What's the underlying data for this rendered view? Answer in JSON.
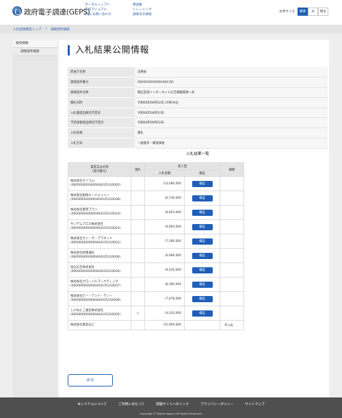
{
  "header": {
    "site_title": "政府電子調達(GEPS)",
    "nav_col1": [
      "ポータルトップへ",
      "操作マニュアル",
      "FAQ･お問い合わせ"
    ],
    "nav_col2": [
      "用語集",
      "トレーニング",
      "調達法令情報"
    ],
    "font_size_label": "文字サイズ",
    "font_sizes": [
      "標準",
      "大",
      "特大"
    ],
    "font_size_selected": "標準"
  },
  "breadcrumb": {
    "items": [
      "入札結果確認トップ",
      "調達案件検索"
    ],
    "separator": ">"
  },
  "sidebar": {
    "heading": "検収情報",
    "items": [
      "調達案件検索"
    ]
  },
  "page": {
    "title": "入札結果公開情報"
  },
  "info": [
    {
      "label": "府省庁名称",
      "value": "法務省"
    },
    {
      "label": "調達案件番号",
      "value": "0000000000000464105"
    },
    {
      "label": "調達案件名称",
      "value": "矯正区域インターネット広告掲載業務一式"
    },
    {
      "label": "開札日時",
      "value": "令和06年08月02日 10時34分"
    },
    {
      "label": "入札書提出締切予定日",
      "value": "令和06年08月02日"
    },
    {
      "label": "予定価格提出締切予定日",
      "value": "令和06年08月02日"
    },
    {
      "label": "入札結果",
      "value": "落札"
    },
    {
      "label": "入札方式",
      "value": "一般競争・最低価格"
    }
  ],
  "results": {
    "title": "入札結果一覧",
    "headers": {
      "name": "業者又は名称\n(受付番号)",
      "award": "落札",
      "round": "第１回",
      "amount": "入札金額",
      "verify": "検証",
      "remarks": "摘要"
    },
    "verify_label": "検証",
    "rows": [
      {
        "name": "株式会社オリコム",
        "no": "(0000000000000464105310002)",
        "award": "",
        "amount": "\\13,480,000",
        "verify": true,
        "remarks": ""
      },
      {
        "name": "株式会社創研エージェンシー",
        "no": "(0000000000000464105310008)",
        "award": "",
        "amount": "\\6,730,000",
        "verify": true,
        "remarks": ""
      },
      {
        "name": "株式会社東邦プラン",
        "no": "(0000000000000464105310010)",
        "award": "",
        "amount": "\\9,603,000",
        "verify": true,
        "remarks": ""
      },
      {
        "name": "サンデムプロス株式会社",
        "no": "(0000000000000464105310003)",
        "award": "",
        "amount": "\\9,660,000",
        "verify": true,
        "remarks": ""
      },
      {
        "name": "株式会社オン・ザ・プラネット",
        "no": "(0000000000000464105310001)",
        "award": "",
        "amount": "\\7,190,000",
        "verify": true,
        "remarks": ""
      },
      {
        "name": "株式会社新東通信",
        "no": "(0000000000000464105310006)",
        "award": "",
        "amount": "\\6,999,000",
        "verify": true,
        "remarks": ""
      },
      {
        "name": "協立広告株式会社",
        "no": "(0000000000000464105310004)",
        "award": "",
        "amount": "\\9,520,000",
        "verify": true,
        "remarks": ""
      },
      {
        "name": "株式会社グローバルマーケティング",
        "no": "(0000000000000464105310007)",
        "award": "",
        "amount": "\\8,390,000",
        "verify": true,
        "remarks": ""
      },
      {
        "name": "株式会社ビー・アンド・ディー",
        "no": "(0000000000000464105310009)",
        "award": "",
        "amount": "\\7,678,000",
        "verify": true,
        "remarks": ""
      },
      {
        "name": "しかねとこ通信株式会社",
        "no": "(0000000000000464105310005)",
        "award": "○",
        "amount": "\\4,243,000",
        "verify": true,
        "remarks": ""
      },
      {
        "name": "株式会社萬羽ほど",
        "no": "",
        "award": "",
        "amount": "\\15,900,000",
        "verify": false,
        "remarks": "不入札"
      }
    ]
  },
  "back_button": "戻る",
  "footer": {
    "links": [
      "本システムについて",
      "ご利用にあたって",
      "関連サイトへのリンク",
      "プライバシーポリシー",
      "サイトマップ"
    ],
    "copyright": "Copyright © Digital Agency All Rights Reserved."
  }
}
